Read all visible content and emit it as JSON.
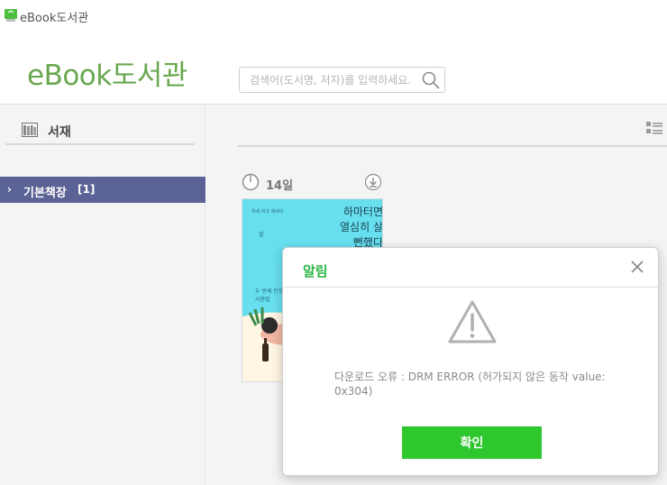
{
  "window": {
    "title": "eBook도서관",
    "icon": "app-window-icon"
  },
  "header": {
    "logo_text": "eBook도서관",
    "search": {
      "placeholder": "검색어(도서명, 저자)를 입력하세요.",
      "value": "",
      "button_icon": "search-icon"
    }
  },
  "sidebar": {
    "library_label": "서재",
    "library_icon": "bookshelf-icon",
    "shelves": [
      {
        "label": "기본책장",
        "count": "[1]",
        "selected": true
      }
    ]
  },
  "main": {
    "view_toggle_icon": "list-view-icon",
    "books": [
      {
        "days_left": "14일",
        "timer_icon": "timer-icon",
        "download_icon": "download-icon",
        "cover": {
          "small_text": "하세 미코 에세이",
          "title": "하마터면 열심히 살 뻔했다",
          "vertical_text": "할",
          "subtext": "두 번째 인생, 행복해지는 마음 사용법"
        }
      }
    ]
  },
  "modal": {
    "title": "알림",
    "close_icon": "close-icon",
    "icon": "warning-icon",
    "message": "다운로드 오류 : DRM ERROR (허가되지 않은 동작 value: 0x304)",
    "confirm_label": "확인"
  },
  "colors": {
    "brand_green": "#6aa84f",
    "selected_shelf": "#5b6295",
    "modal_title": "#2bb548",
    "confirm_button": "#2ec72e",
    "book_cover": "#67dfef"
  }
}
